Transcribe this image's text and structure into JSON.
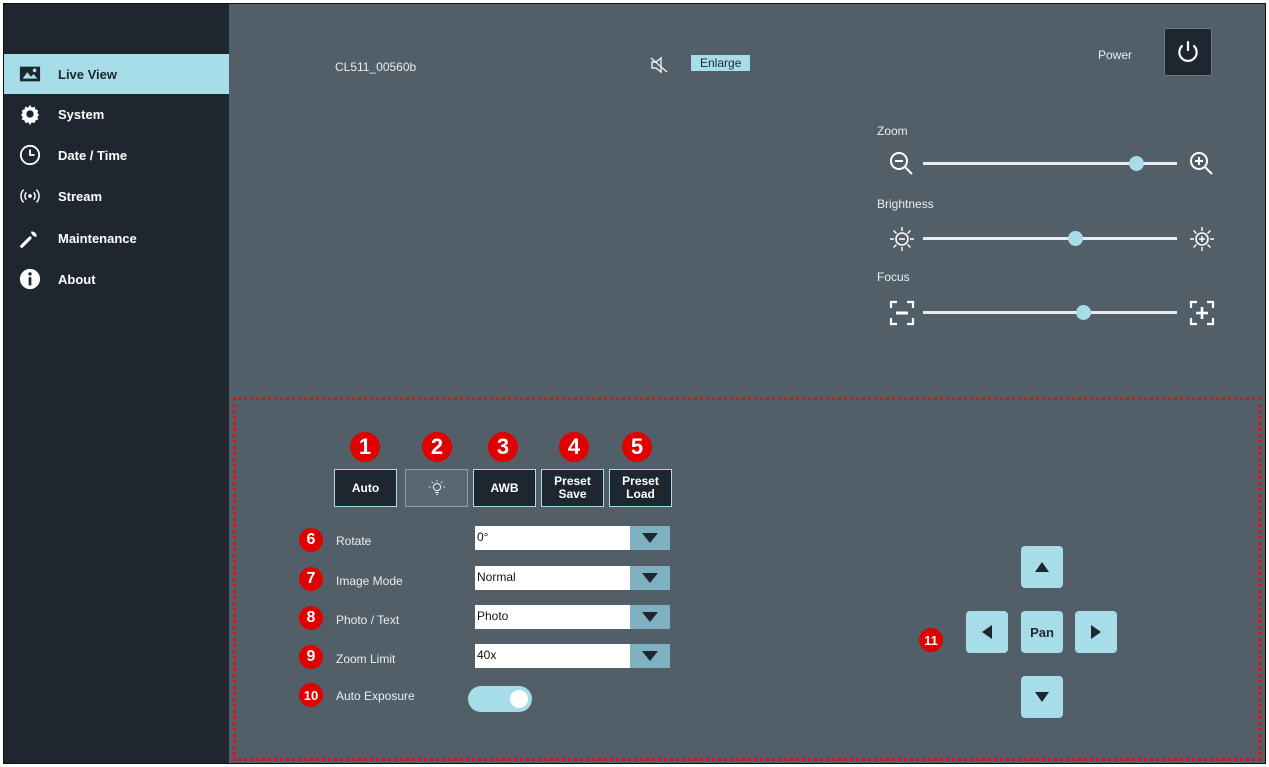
{
  "sidebar": {
    "items": [
      {
        "label": "Live View",
        "icon": "image-icon",
        "active": true
      },
      {
        "label": "System",
        "icon": "gear-icon"
      },
      {
        "label": "Date / Time",
        "icon": "clock-icon"
      },
      {
        "label": "Stream",
        "icon": "broadcast-icon"
      },
      {
        "label": "Maintenance",
        "icon": "wrench-icon"
      },
      {
        "label": "About",
        "icon": "info-icon"
      }
    ]
  },
  "header": {
    "device_name": "CL511_00560b",
    "mute_icon": "speaker-muted-icon",
    "enlarge_label": "Enlarge",
    "power_label": "Power"
  },
  "sliders": {
    "zoom": {
      "label": "Zoom",
      "value": 0.84
    },
    "brightness": {
      "label": "Brightness",
      "value": 0.6
    },
    "focus": {
      "label": "Focus",
      "value": 0.63
    }
  },
  "toolbar": {
    "auto_label": "Auto",
    "awb_label": "AWB",
    "preset_save_label": "Preset\nSave",
    "preset_load_label": "Preset\nLoad"
  },
  "markers": [
    "1",
    "2",
    "3",
    "4",
    "5",
    "6",
    "7",
    "8",
    "9",
    "10",
    "11"
  ],
  "settings": {
    "rotate": {
      "label": "Rotate",
      "value": "0°"
    },
    "image_mode": {
      "label": "Image Mode",
      "value": "Normal"
    },
    "photo_text": {
      "label": "Photo / Text",
      "value": "Photo"
    },
    "zoom_limit": {
      "label": "Zoom Limit",
      "value": "40x"
    },
    "auto_exposure": {
      "label": "Auto Exposure",
      "on": true
    }
  },
  "pan": {
    "label": "Pan"
  },
  "colors": {
    "accent": "#a7dde9",
    "sidebar": "#1e2630",
    "main": "#525f68",
    "marker": "#e00000"
  }
}
